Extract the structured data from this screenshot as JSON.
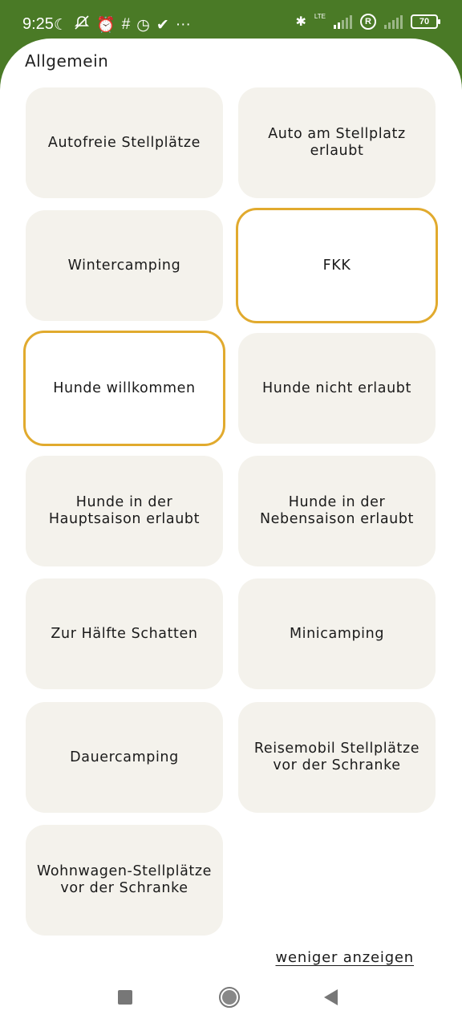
{
  "status_bar": {
    "time": "9:25",
    "network_type": "LTE",
    "roaming_badge": "R",
    "battery_level": "70",
    "icons_left": [
      "moon-icon",
      "notifications-off-icon",
      "alarm-icon",
      "slack-icon",
      "clock-icon",
      "check-icon",
      "more-icon"
    ],
    "icons_right": [
      "bluetooth-icon",
      "signal-icon",
      "roaming-icon",
      "signal-icon",
      "battery-icon"
    ]
  },
  "section": {
    "title": "Allgemein"
  },
  "tiles": [
    {
      "label": "Autofreie Stellplätze",
      "selected": false
    },
    {
      "label": "Auto am Stellplatz erlaubt",
      "selected": false
    },
    {
      "label": "Wintercamping",
      "selected": false
    },
    {
      "label": "FKK",
      "selected": true
    },
    {
      "label": "Hunde willkommen",
      "selected": true
    },
    {
      "label": "Hunde nicht erlaubt",
      "selected": false
    },
    {
      "label": "Hunde in der Hauptsaison erlaubt",
      "selected": false
    },
    {
      "label": "Hunde in der Nebensaison erlaubt",
      "selected": false
    },
    {
      "label": "Zur Hälfte Schatten",
      "selected": false
    },
    {
      "label": "Minicamping",
      "selected": false
    },
    {
      "label": "Dauercamping",
      "selected": false
    },
    {
      "label": "Reisemobil Stellplätze vor der Schranke",
      "selected": false
    },
    {
      "label": "Wohnwagen-Stellplätze vor der Schranke",
      "selected": false
    }
  ],
  "show_less_link": "weniger anzeigen",
  "colors": {
    "header_green": "#4a7a26",
    "tile_background": "#f4f2ec",
    "selected_border": "#e1aa2e"
  }
}
